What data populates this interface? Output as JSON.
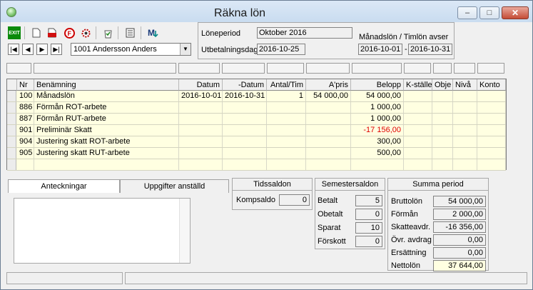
{
  "window": {
    "title": "Räkna lön"
  },
  "window_controls": {
    "minimize": "–",
    "maximize": "□",
    "close": "✕"
  },
  "toolbar": {
    "exit_label": "EXIT"
  },
  "nav": {
    "first": "|◀",
    "prev": "◀",
    "next": "▶",
    "last": "▶|",
    "employee_value": "1001 Andersson Anders"
  },
  "period": {
    "loneperiod_label": "Löneperiod",
    "loneperiod_value": "Oktober 2016",
    "utbetalningsdag_label": "Utbetalningsdag",
    "utbetalningsdag_value": "2016-10-25",
    "avser_label": "Månadslön / Timlön avser",
    "from": "2016-10-01",
    "dash": "-",
    "to": "2016-10-31"
  },
  "table": {
    "columns": [
      "Nr",
      "Benämning",
      "Datum",
      "-Datum",
      "Antal/Tim",
      "A'pris",
      "Belopp",
      "K-ställe",
      "Obje",
      "Nivå",
      "Konto"
    ],
    "rows": [
      {
        "nr": "100",
        "name": "Månadslön",
        "datum": "2016-10-01",
        "tdatum": "2016-10-31",
        "antal": "1",
        "apris": "54 000,00",
        "belopp": "54 000,00"
      },
      {
        "nr": "886",
        "name": "Förmån ROT-arbete",
        "datum": "",
        "tdatum": "",
        "antal": "",
        "apris": "",
        "belopp": "1 000,00"
      },
      {
        "nr": "887",
        "name": "Förmån RUT-arbete",
        "datum": "",
        "tdatum": "",
        "antal": "",
        "apris": "",
        "belopp": "1 000,00"
      },
      {
        "nr": "901",
        "name": "Preliminär Skatt",
        "datum": "",
        "tdatum": "",
        "antal": "",
        "apris": "",
        "belopp": "-17 156,00"
      },
      {
        "nr": "904",
        "name": "Justering skatt ROT-arbete",
        "datum": "",
        "tdatum": "",
        "antal": "",
        "apris": "",
        "belopp": "300,00"
      },
      {
        "nr": "905",
        "name": "Justering skatt RUT-arbete",
        "datum": "",
        "tdatum": "",
        "antal": "",
        "apris": "",
        "belopp": "500,00"
      }
    ]
  },
  "tabs": {
    "anteckningar": "Anteckningar",
    "uppgifter": "Uppgifter anställd"
  },
  "tidssaldon": {
    "title": "Tidssaldon",
    "kompsaldo_label": "Kompsaldo",
    "kompsaldo_value": "0"
  },
  "semestersaldon": {
    "title": "Semestersaldon",
    "items": [
      {
        "label": "Betalt",
        "value": "5"
      },
      {
        "label": "Obetalt",
        "value": "0"
      },
      {
        "label": "Sparat",
        "value": "10"
      },
      {
        "label": "Förskott",
        "value": "0"
      }
    ]
  },
  "summa": {
    "title": "Summa period",
    "items": [
      {
        "label": "Bruttolön",
        "value": "54 000,00"
      },
      {
        "label": "Förmån",
        "value": "2 000,00"
      },
      {
        "label": "Skatteavdr.",
        "value": "-16 356,00"
      },
      {
        "label": "Övr. avdrag",
        "value": "0,00"
      },
      {
        "label": "Ersättning",
        "value": "0,00"
      },
      {
        "label": "Nettolön",
        "value": "37 644,00"
      }
    ]
  },
  "colors": {
    "negative": "#e00000",
    "highlight": "#ffffe1"
  }
}
